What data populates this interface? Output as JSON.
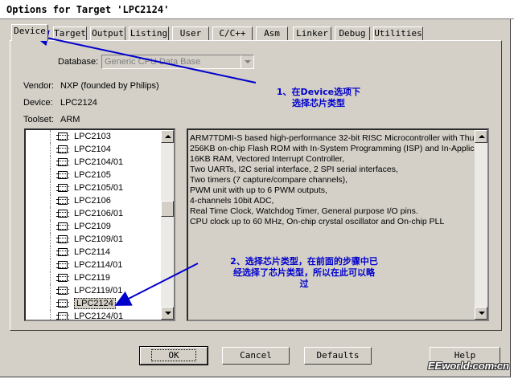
{
  "window": {
    "title": "Options for Target 'LPC2124'"
  },
  "tabs": [
    {
      "label": "Device",
      "active": true
    },
    {
      "label": "Target"
    },
    {
      "label": "Output"
    },
    {
      "label": "Listing"
    },
    {
      "label": "User"
    },
    {
      "label": "C/C++"
    },
    {
      "label": "Asm"
    },
    {
      "label": "Linker"
    },
    {
      "label": "Debug"
    },
    {
      "label": "Utilities"
    }
  ],
  "device": {
    "database_label": "Database:",
    "database_value": "Generic CPU Data Base",
    "vendor_label": "Vendor:",
    "vendor_value": "NXP (founded by Philips)",
    "device_label": "Device:",
    "device_value": "LPC2124",
    "toolset_label": "Toolset:",
    "toolset_value": "ARM"
  },
  "device_list": {
    "items": [
      "LPC2103",
      "LPC2104",
      "LPC2104/01",
      "LPC2105",
      "LPC2105/01",
      "LPC2106",
      "LPC2106/01",
      "LPC2109",
      "LPC2109/01",
      "LPC2114",
      "LPC2114/01",
      "LPC2119",
      "LPC2119/01",
      "LPC2124",
      "LPC2124/01"
    ],
    "selected": "LPC2124"
  },
  "description": {
    "lines": [
      "ARM7TDMI-S based high-performance 32-bit RISC Microcontroller with Thu",
      "256KB on-chip Flash ROM with In-System Programming (ISP) and In-Applica",
      "16KB RAM, Vectored Interrupt Controller,",
      "Two UARTs, I2C serial interface, 2 SPI serial interfaces,",
      "Two timers (7 capture/compare channels),",
      "PWM unit with up to 6 PWM outputs,",
      "4-channels 10bit ADC,",
      "Real Time Clock, Watchdog Timer, General purpose I/O pins.",
      "CPU clock up to 60 MHz, On-chip crystal oscillator and On-chip PLL"
    ]
  },
  "buttons": {
    "ok": "OK",
    "cancel": "Cancel",
    "defaults": "Defaults",
    "help": "Help"
  },
  "annotations": {
    "note1_line1": "1、在Device选项下",
    "note1_line2": "选择芯片类型",
    "note2_line1": "2、选择芯片类型，在前面的步骤中已",
    "note2_line2": "经选择了芯片类型，所以在此可以略",
    "note2_line3": "过"
  },
  "watermark": "EEworld.com.cn",
  "colors": {
    "annotation": "#0000cc",
    "dialog_bg": "#d4d0c8"
  },
  "icons": {
    "device_item": "chip-icon"
  }
}
